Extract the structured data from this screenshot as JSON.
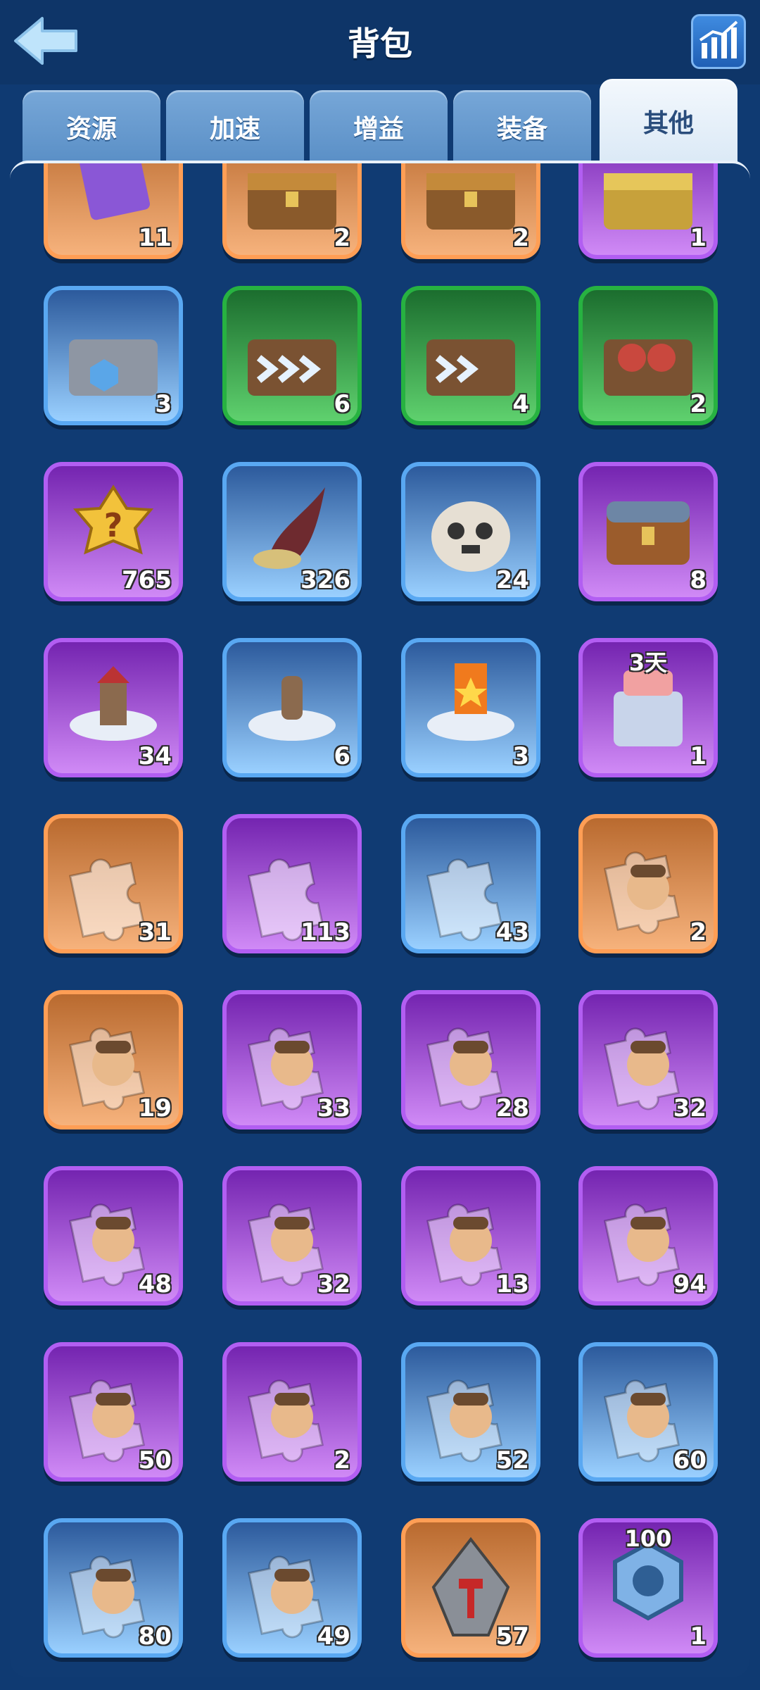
{
  "header": {
    "title": "背包"
  },
  "tabs": [
    {
      "label": "资源",
      "active": false
    },
    {
      "label": "加速",
      "active": false
    },
    {
      "label": "增益",
      "active": false
    },
    {
      "label": "装备",
      "active": false
    },
    {
      "label": "其他",
      "active": true
    }
  ],
  "items": [
    {
      "count": "11",
      "rarity": "orange",
      "icon": "purple-card-icon"
    },
    {
      "count": "2",
      "rarity": "orange",
      "icon": "treasure-chest-icon"
    },
    {
      "count": "2",
      "rarity": "orange",
      "icon": "treasure-chest-icon"
    },
    {
      "count": "1",
      "rarity": "purple",
      "icon": "gold-chest-icon"
    },
    {
      "count": "3",
      "rarity": "blue",
      "icon": "iron-chest-icon"
    },
    {
      "count": "6",
      "rarity": "green",
      "icon": "speedup-chest-icon"
    },
    {
      "count": "4",
      "rarity": "green",
      "icon": "hero-chest-icon"
    },
    {
      "count": "2",
      "rarity": "green",
      "icon": "food-chest-icon"
    },
    {
      "count": "765",
      "rarity": "purple",
      "icon": "mystery-badge-icon"
    },
    {
      "count": "326",
      "rarity": "blue",
      "icon": "horn-icon"
    },
    {
      "count": "24",
      "rarity": "blue",
      "icon": "skull-sack-icon"
    },
    {
      "count": "8",
      "rarity": "purple",
      "icon": "puzzle-chest-icon"
    },
    {
      "count": "34",
      "rarity": "purple",
      "icon": "relocate-tower-icon"
    },
    {
      "count": "6",
      "rarity": "blue",
      "icon": "relocate-statue-icon"
    },
    {
      "count": "3",
      "rarity": "blue",
      "icon": "relocate-banner-icon"
    },
    {
      "count": "1",
      "rarity": "purple",
      "icon": "castle-skin-icon",
      "tag": "3天"
    },
    {
      "count": "31",
      "rarity": "orange",
      "icon": "puzzle-piece-icon"
    },
    {
      "count": "113",
      "rarity": "purple",
      "icon": "puzzle-piece-icon"
    },
    {
      "count": "43",
      "rarity": "blue",
      "icon": "puzzle-piece-icon"
    },
    {
      "count": "2",
      "rarity": "orange",
      "icon": "hero-fragment-icon"
    },
    {
      "count": "19",
      "rarity": "orange",
      "icon": "hero-fragment-icon"
    },
    {
      "count": "33",
      "rarity": "purple",
      "icon": "hero-fragment-icon"
    },
    {
      "count": "28",
      "rarity": "purple",
      "icon": "hero-fragment-icon"
    },
    {
      "count": "32",
      "rarity": "purple",
      "icon": "hero-fragment-icon"
    },
    {
      "count": "48",
      "rarity": "purple",
      "icon": "hero-fragment-icon"
    },
    {
      "count": "32",
      "rarity": "purple",
      "icon": "hero-fragment-icon"
    },
    {
      "count": "13",
      "rarity": "purple",
      "icon": "hero-fragment-icon"
    },
    {
      "count": "94",
      "rarity": "purple",
      "icon": "hero-fragment-icon"
    },
    {
      "count": "50",
      "rarity": "purple",
      "icon": "hero-fragment-icon"
    },
    {
      "count": "2",
      "rarity": "purple",
      "icon": "hero-fragment-icon"
    },
    {
      "count": "52",
      "rarity": "blue",
      "icon": "hero-fragment-icon"
    },
    {
      "count": "60",
      "rarity": "blue",
      "icon": "hero-fragment-icon"
    },
    {
      "count": "80",
      "rarity": "blue",
      "icon": "hero-fragment-icon"
    },
    {
      "count": "49",
      "rarity": "blue",
      "icon": "hero-fragment-icon"
    },
    {
      "count": "57",
      "rarity": "orange",
      "icon": "hammer-stone-icon"
    },
    {
      "count": "1",
      "rarity": "purple",
      "icon": "hex-nut-icon",
      "tag": "100"
    }
  ]
}
